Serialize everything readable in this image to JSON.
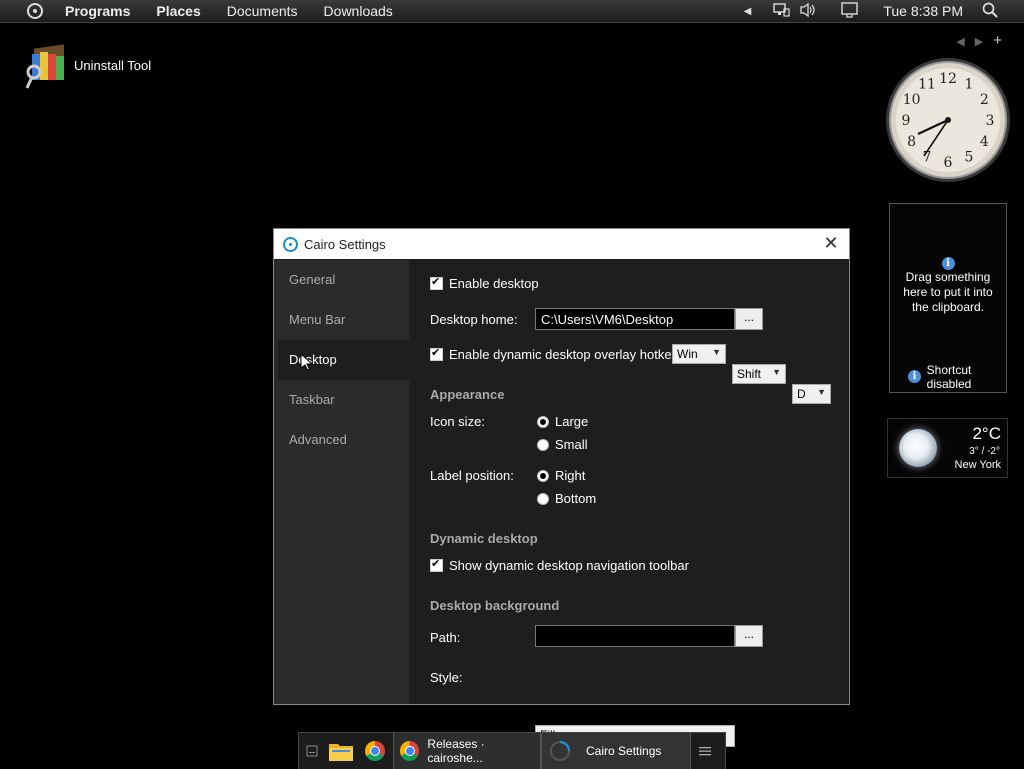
{
  "menubar": {
    "items": [
      "Programs",
      "Places",
      "Documents",
      "Downloads"
    ],
    "clock": "Tue 8:38 PM"
  },
  "desktop": {
    "icons": [
      {
        "label": "Uninstall Tool",
        "icon": "uninstall-tool-icon"
      }
    ]
  },
  "widgets": {
    "clock_numbers": [
      "12",
      "1",
      "2",
      "3",
      "4",
      "5",
      "6",
      "7",
      "8",
      "9",
      "10",
      "11"
    ],
    "clipboard": {
      "message": "Drag something here to put it into the clipboard.",
      "shortcut": "Shortcut disabled"
    },
    "weather": {
      "temp": "2°C",
      "range": "3° / -2°",
      "city": "New York"
    }
  },
  "window": {
    "title": "Cairo Settings",
    "close": "✕",
    "nav": [
      "General",
      "Menu Bar",
      "Desktop",
      "Taskbar",
      "Advanced"
    ],
    "active_nav": "Desktop",
    "enable_desktop": "Enable desktop",
    "desktop_home_label": "Desktop home:",
    "desktop_home_value": "C:\\Users\\VM6\\Desktop",
    "browse_label": "...",
    "hotkey_label": "Enable dynamic desktop overlay hotkey:",
    "hotkey": [
      "Win",
      "Shift",
      "D"
    ],
    "appearance_heading": "Appearance",
    "icon_size_label": "Icon size:",
    "icon_size_options": [
      "Large",
      "Small"
    ],
    "label_position_label": "Label position:",
    "label_position_options": [
      "Right",
      "Bottom"
    ],
    "dynamic_heading": "Dynamic desktop",
    "show_toolbar": "Show dynamic desktop navigation toolbar",
    "background_heading": "Desktop background",
    "path_label": "Path:",
    "path_value": "",
    "style_label": "Style:",
    "style_value": "Fill"
  },
  "taskbar": {
    "tasks": [
      "Releases · cairoshe...",
      "Cairo Settings"
    ]
  },
  "colors": {
    "accent": "#1d8cc9",
    "window_bg": "#1e1e1e",
    "nav_bg": "#2b2b2b"
  }
}
